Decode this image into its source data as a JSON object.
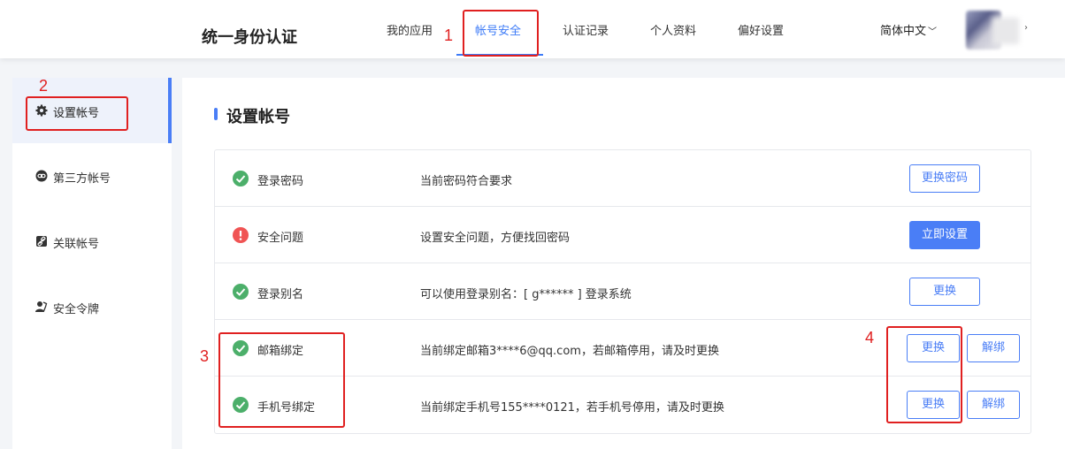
{
  "header": {
    "title": "统一身份认证",
    "nav": [
      "我的应用",
      "帐号安全",
      "认证记录",
      "个人资料",
      "偏好设置"
    ],
    "active_nav": "帐号安全",
    "language": "简体中文",
    "language_caret": "﹀",
    "avatar_caret": "›"
  },
  "sidebar": {
    "items": [
      {
        "label": "设置帐号",
        "icon": "gear-icon"
      },
      {
        "label": "第三方帐号",
        "icon": "link-icon"
      },
      {
        "label": "关联帐号",
        "icon": "chain-icon"
      },
      {
        "label": "安全令牌",
        "icon": "user-token-icon"
      }
    ]
  },
  "main": {
    "section_title": "设置帐号",
    "rows": [
      {
        "name": "登录密码",
        "status": "ok",
        "desc": "当前密码符合要求",
        "buttons": [
          "更换密码"
        ]
      },
      {
        "name": "安全问题",
        "status": "warn",
        "desc": "设置安全问题，方便找回密码",
        "buttons": [
          "立即设置"
        ]
      },
      {
        "name": "登录别名",
        "status": "ok",
        "desc": "可以使用登录别名：[ g****** ] 登录系统",
        "buttons": [
          "更换"
        ]
      },
      {
        "name": "邮箱绑定",
        "status": "ok",
        "desc": "当前绑定邮箱3****6@qq.com，若邮箱停用，请及时更换",
        "buttons": [
          "更换",
          "解绑"
        ]
      },
      {
        "name": "手机号绑定",
        "status": "ok",
        "desc": "当前绑定手机号155****0121，若手机号停用，请及时更换",
        "buttons": [
          "更换",
          "解绑"
        ]
      }
    ]
  },
  "annotations": [
    "1",
    "2",
    "3",
    "4"
  ],
  "colors": {
    "accent": "#4a7ef6",
    "ok": "#4caf6a",
    "warn": "#f05454",
    "annotation": "#e02020"
  }
}
